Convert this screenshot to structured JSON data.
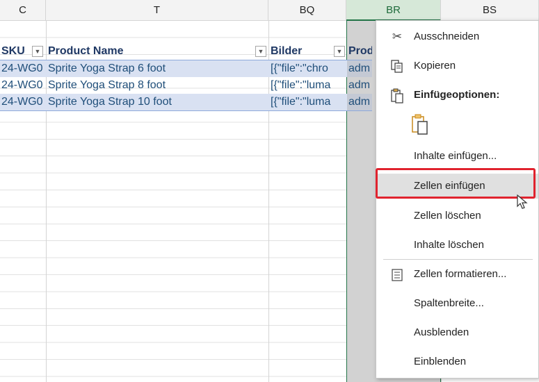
{
  "columns": [
    {
      "id": "C",
      "label": "C"
    },
    {
      "id": "T",
      "label": "T"
    },
    {
      "id": "BQ",
      "label": "BQ"
    },
    {
      "id": "BR",
      "label": "BR"
    },
    {
      "id": "BS",
      "label": "BS"
    }
  ],
  "table": {
    "headers": [
      "SKU",
      "Product Name",
      "Bilder",
      "Prod"
    ],
    "rows": [
      [
        "24-WG0",
        "Sprite Yoga Strap 6 foot",
        "[{\"file\":\"chro",
        "adm"
      ],
      [
        "24-WG0",
        "Sprite Yoga Strap 8 foot",
        "[{\"file\":\"luma",
        "adm"
      ],
      [
        "24-WG0",
        "Sprite Yoga Strap 10 foot",
        "[{\"file\":\"luma",
        "adm"
      ]
    ]
  },
  "context_menu": {
    "cut": "Ausschneiden",
    "copy": "Kopieren",
    "paste_options": "Einfügeoptionen:",
    "paste_special": "Inhalte einfügen...",
    "insert_cells": "Zellen einfügen",
    "delete_cells": "Zellen löschen",
    "clear_contents": "Inhalte löschen",
    "format_cells": "Zellen formatieren...",
    "column_width": "Spaltenbreite...",
    "hide": "Ausblenden",
    "unhide": "Einblenden"
  },
  "colors": {
    "accent": "#217346",
    "highlight": "#e0232e",
    "table_band": "#d9e1f2"
  },
  "icons": [
    "scissors-icon",
    "copy-icon",
    "paste-icon",
    "paste-clipboard-icon",
    "format-cells-icon",
    "mouse-cursor-icon"
  ]
}
